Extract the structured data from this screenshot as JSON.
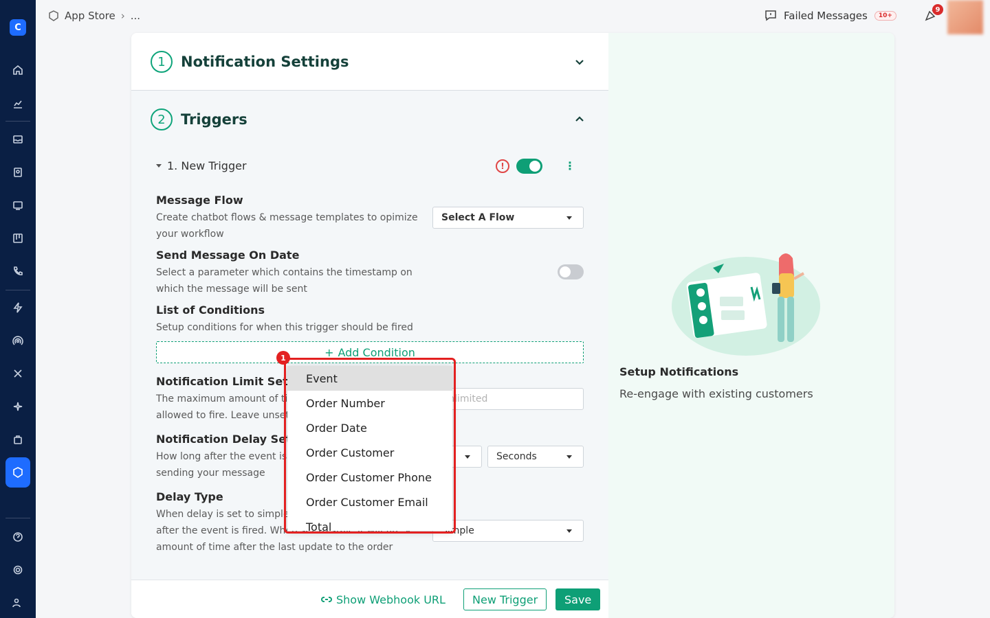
{
  "breadcrumb": {
    "root": "App Store",
    "rest": "..."
  },
  "topbar": {
    "failed_label": "Failed Messages",
    "failed_badge": "10+",
    "notif_count": "9"
  },
  "sections": {
    "settings": {
      "step": "1",
      "title": "Notification Settings"
    },
    "triggers": {
      "step": "2",
      "title": "Triggers"
    }
  },
  "trigger": {
    "name": "1. New Trigger",
    "enabled": true
  },
  "message_flow": {
    "title": "Message Flow",
    "desc": "Create chatbot flows & message templates to opimize your workflow",
    "select_value": "Select A Flow"
  },
  "send_on_date": {
    "title": "Send Message On Date",
    "desc": "Select a parameter which contains the timestamp on which the message will be sent",
    "enabled": false
  },
  "conditions": {
    "title": "List of Conditions",
    "desc": "Setup conditions for when this trigger should be fired",
    "add_label": "Add Condition"
  },
  "limit": {
    "title": "Notification Limit Settings",
    "desc": "The maximum amount of times this trigger should be allowed to fire. Leave unset for",
    "placeholder": "Unlimited"
  },
  "delay": {
    "title": "Notification Delay Settings",
    "desc": "How long after the event is triggered to wait before sending your message",
    "unit": "Seconds"
  },
  "delay_type": {
    "title": "Delay Type",
    "desc": "When delay is set to simple it will fire X amount of time after the event is fired. When set to stale it will fire X amount of time after the last update to the order",
    "value": "Simple"
  },
  "footer": {
    "webhook": "Show Webhook URL",
    "new_trigger": "New Trigger",
    "save": "Save"
  },
  "right_pane": {
    "title": "Setup Notifications",
    "subtitle": "Re-engage with existing customers"
  },
  "dropdown": {
    "options": [
      "Event",
      "Order Number",
      "Order Date",
      "Order Customer",
      "Order Customer Phone",
      "Order Customer Email",
      "Total"
    ],
    "selected": "Event"
  },
  "annotation": {
    "badge": "1"
  },
  "colors": {
    "accent": "#0e9f76",
    "sidebar": "#0a1f44",
    "active_nav": "#1e6cff",
    "danger": "#e32020"
  }
}
